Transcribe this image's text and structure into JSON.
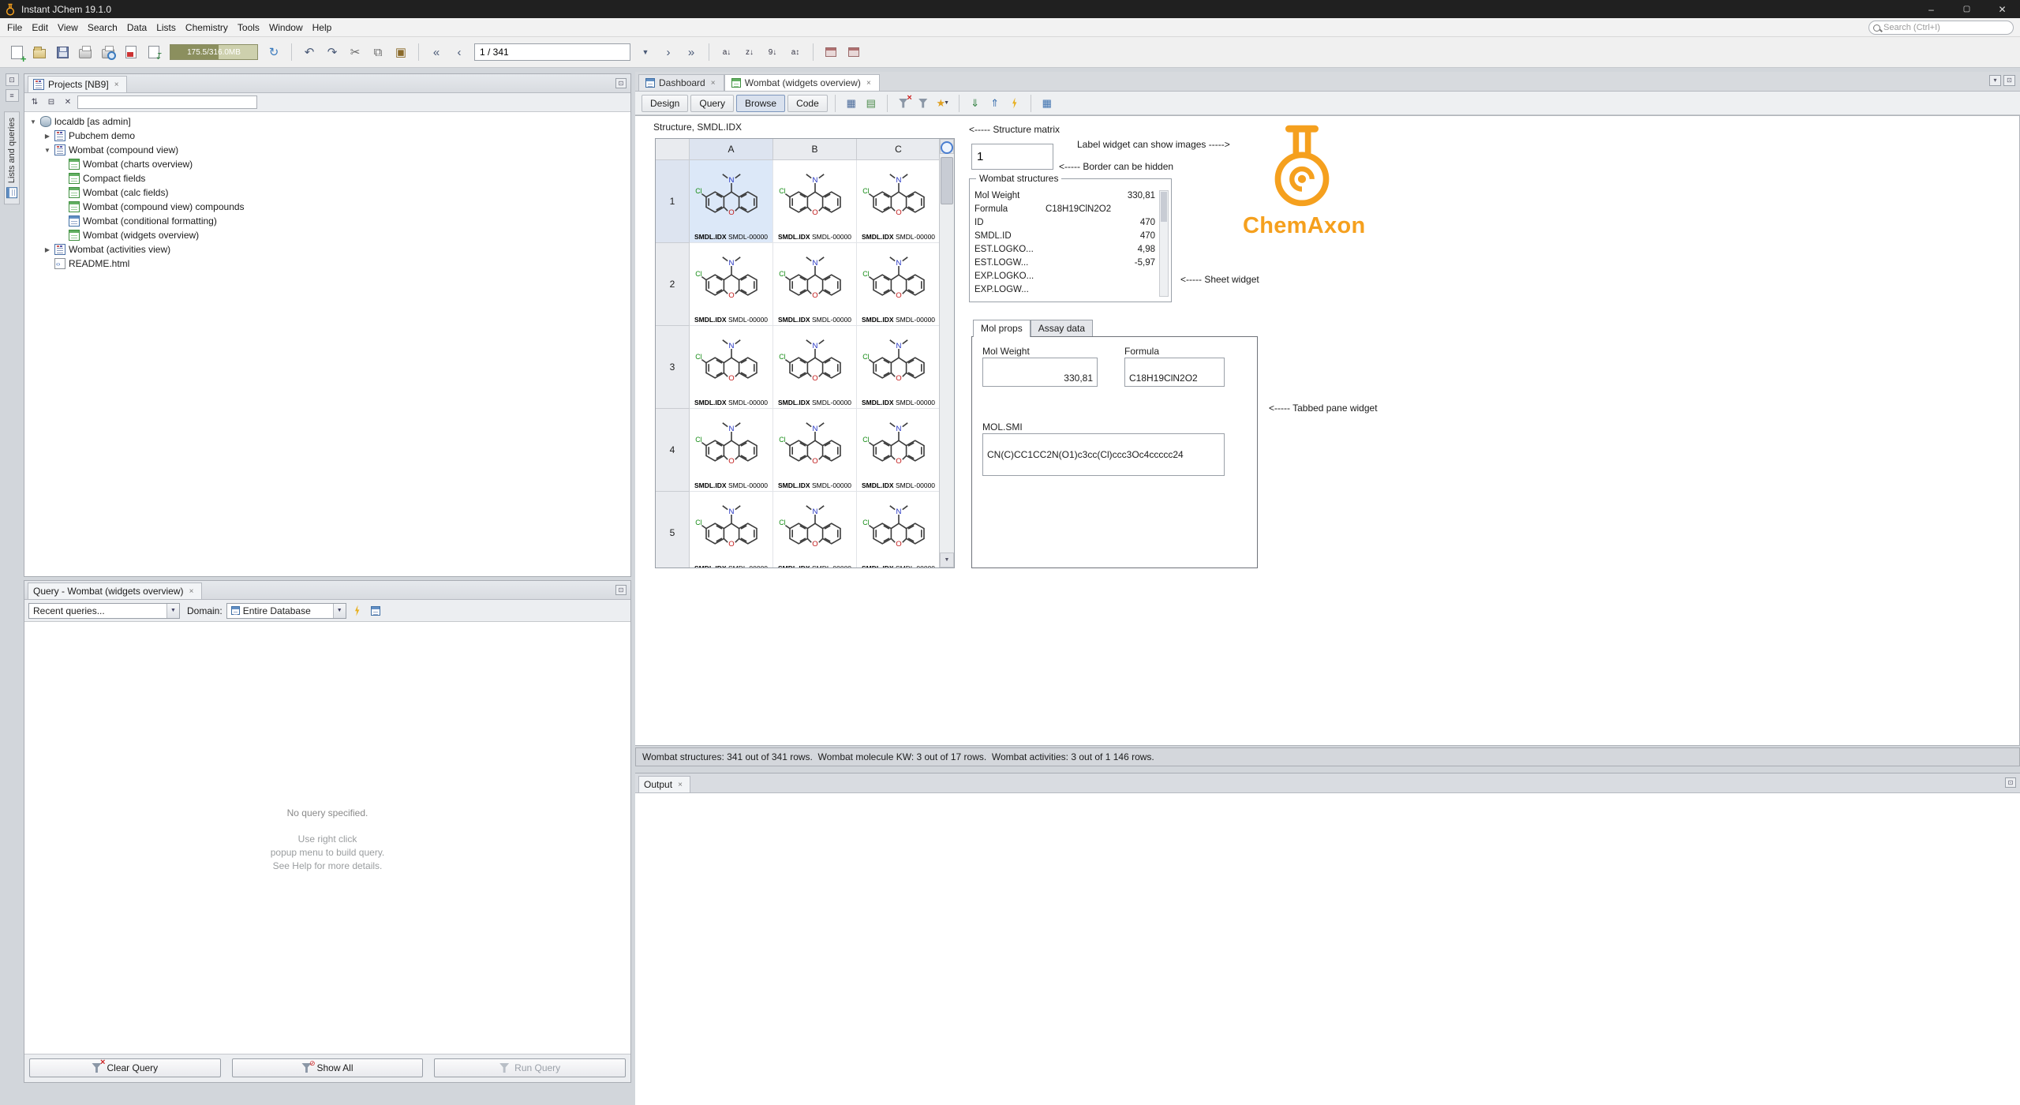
{
  "window": {
    "title": "Instant JChem 19.1.0"
  },
  "menubar": {
    "items": [
      "File",
      "Edit",
      "View",
      "Search",
      "Data",
      "Lists",
      "Chemistry",
      "Tools",
      "Window",
      "Help"
    ],
    "search_placeholder": "Search (Ctrl+I)"
  },
  "toolbar": {
    "memory": "175.5/316.0MB",
    "record_field": "1 / 341"
  },
  "left_strip": {
    "vertical_tab": "Lists and queries"
  },
  "projects_panel": {
    "tab_label": "Projects [NB9]",
    "filter_value": "",
    "tree": [
      {
        "label": "localdb [as admin]"
      },
      {
        "label": "Pubchem demo"
      },
      {
        "label": "Wombat (compound view)"
      },
      {
        "label": "Wombat (charts overview)"
      },
      {
        "label": "Compact fields"
      },
      {
        "label": "Wombat (calc fields)"
      },
      {
        "label": "Wombat (compound view) compounds"
      },
      {
        "label": "Wombat (conditional formatting)"
      },
      {
        "label": "Wombat (widgets overview)"
      },
      {
        "label": "Wombat (activities view)"
      },
      {
        "label": "README.html"
      }
    ]
  },
  "query_panel": {
    "tab_label": "Query - Wombat (widgets overview)",
    "recent_queries": "Recent queries...",
    "domain_label": "Domain:",
    "domain_value": "Entire Database",
    "no_query": "No query specified.",
    "hint_line1": "Use right click",
    "hint_line2": "popup menu to build query.",
    "hint_line3": "See Help for more details.",
    "clear_button": "Clear Query",
    "show_all_button": "Show All",
    "run_button": "Run Query"
  },
  "editor": {
    "tab_dashboard": "Dashboard",
    "tab_wombat": "Wombat (widgets overview)",
    "mode_design": "Design",
    "mode_query": "Query",
    "mode_browse": "Browse",
    "mode_code": "Code"
  },
  "form": {
    "structure_field_label": "Structure, SMDL.IDX",
    "matrix": {
      "columns": [
        "A",
        "B",
        "C"
      ],
      "rows": [
        "1",
        "2",
        "3",
        "4",
        "5"
      ],
      "caption_bold": "SMDL.IDX",
      "caption_text": "SMDL-00000"
    },
    "annotation_matrix": "<----- Structure matrix",
    "annotation_label": "Label widget can show images ----->",
    "annotation_border": "<----- Border can be hidden",
    "annotation_sheet": "<----- Sheet widget",
    "annotation_tabbed": "<----- Tabbed pane widget",
    "label_field_value": "1",
    "sheet": {
      "title": "Wombat structures",
      "rows": [
        {
          "label": "Mol Weight",
          "value": "330,81"
        },
        {
          "label": "Formula",
          "value": "C18H19ClN2O2"
        },
        {
          "label": "ID",
          "value": "470"
        },
        {
          "label": "SMDL.ID",
          "value": "470"
        },
        {
          "label": "EST.LOGKO...",
          "value": "4,98"
        },
        {
          "label": "EST.LOGW...",
          "value": "-5,97"
        },
        {
          "label": "EXP.LOGKO...",
          "value": ""
        },
        {
          "label": "EXP.LOGW...",
          "value": ""
        }
      ]
    },
    "logo_text": "ChemAxon",
    "tabbed": {
      "tab_mol_props": "Mol props",
      "tab_assay_data": "Assay data",
      "mol_weight_label": "Mol Weight",
      "mol_weight_value": "330,81",
      "formula_label": "Formula",
      "formula_value": "C18H19ClN2O2",
      "mol_smi_label": "MOL.SMI",
      "mol_smi_value": "CN(C)CC1CC2N(O1)c3cc(Cl)ccc3Oc4ccccc24"
    }
  },
  "status_bar": "Wombat structures: 341 out of 341 rows.  Wombat molecule KW: 3 out of 17 rows.  Wombat activities: 3 out of 1 146 rows.",
  "output_panel": {
    "tab_label": "Output"
  }
}
